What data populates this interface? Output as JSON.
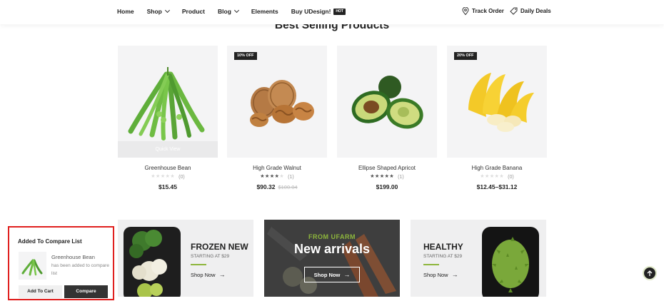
{
  "nav": {
    "items": [
      "Home",
      "Shop",
      "Product",
      "Blog",
      "Elements",
      "Buy UDesign!"
    ],
    "hot_badge": "HOT",
    "track_order": "Track Order",
    "daily_deals": "Daily Deals"
  },
  "section_title": "Best Selling Products",
  "products": [
    {
      "name": "Greenhouse Bean",
      "rating": 0,
      "reviews": "(0)",
      "price": "$15.45",
      "old_price": "",
      "badge": "",
      "hover_label": "Quick View"
    },
    {
      "name": "High Grade Walnut",
      "rating": 0.8,
      "reviews": "(1)",
      "price": "$90.32",
      "old_price": "$100.04",
      "badge": "10% OFF"
    },
    {
      "name": "Ellipse Shaped Apricot",
      "rating": 1.0,
      "reviews": "(1)",
      "price": "$199.00",
      "old_price": "",
      "badge": ""
    },
    {
      "name": "High Grade Banana",
      "rating": 0,
      "reviews": "(0)",
      "price": "$12.45–$31.12",
      "old_price": "",
      "badge": "20% OFF"
    }
  ],
  "banners": [
    {
      "title": "FROZEN NEW",
      "subtitle": "STARTING AT $29",
      "link": "Shop Now"
    },
    {
      "eyebrow": "FROM UFARM",
      "title": "New arrivals",
      "button": "Shop Now"
    },
    {
      "title": "HEALTHY",
      "subtitle": "STARTING AT $29",
      "link": "Shop Now"
    }
  ],
  "compare_popup": {
    "title": "Added To Compare List",
    "product_name": "Greenhouse Bean",
    "message": "has been added to compare list",
    "add_to_cart": "Add To Cart",
    "compare": "Compare"
  },
  "colors": {
    "accent_green": "#8db63c",
    "highlight_red": "#e0201f",
    "dark": "#222222"
  }
}
